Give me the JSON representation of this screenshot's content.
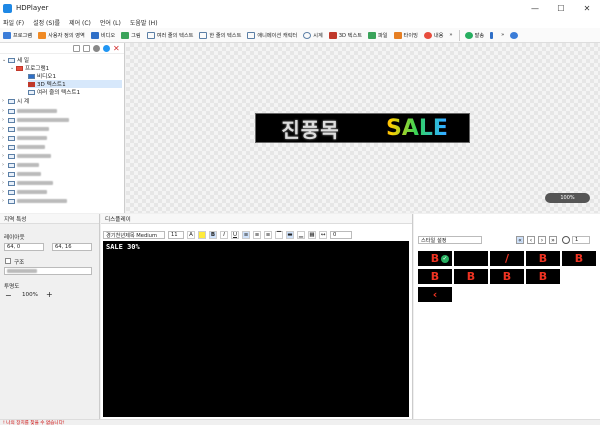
{
  "window": {
    "title": "HDPlayer",
    "min": "—",
    "max": "☐",
    "close": "✕"
  },
  "menu": [
    "파일 (F)",
    "설정 (S)를",
    "제어 (C)",
    "언어 (L)",
    "도움말 (H)"
  ],
  "toolbar": {
    "items": [
      {
        "label": "프로그램",
        "color": "#3b7dd8"
      },
      {
        "label": "사용자 정의 영역",
        "color": "#f08a24"
      },
      {
        "label": "비디오",
        "color": "#2f6fc7"
      },
      {
        "label": "그림",
        "color": "#3aa35a"
      },
      {
        "label": "여러 줄의 텍스트",
        "color": "#5b7fa6"
      },
      {
        "label": "한 줄의 텍스트",
        "color": "#5b7fa6"
      },
      {
        "label": "애니메이션 캐릭터",
        "color": "#5b7fa6"
      },
      {
        "label": "시계",
        "color": "#5b7fa6"
      },
      {
        "label": "3D 텍스트",
        "color": "#c0392b"
      },
      {
        "label": "파일",
        "color": "#3aa35a"
      },
      {
        "label": "타이밍",
        "color": "#e67e22"
      },
      {
        "label": "내용",
        "color": "#e74c3c"
      },
      {
        "label": "발송",
        "color": "#27ae60"
      }
    ],
    "more": "»"
  },
  "tree": {
    "screen_label": "세 일",
    "program_label": "프로그램1",
    "items": [
      "비디오1",
      "3D 텍스트1",
      "여러 줄의 텍스트1"
    ],
    "screen2_label": "시 계"
  },
  "preview": {
    "korean_text": "진풍목",
    "sale_text": "SALE",
    "zoom": "100%"
  },
  "props": {
    "header": "지역 특성",
    "area_label": "레이아웃",
    "pos_x": "64, 0",
    "size": "64, 16",
    "border_label": "구조",
    "transparency_label": "투명도",
    "transparency_value": "100%"
  },
  "display": {
    "header": "디스플레이",
    "font": "경기천년제목 Medium",
    "size": "11",
    "bold": "B",
    "italic": "I",
    "underline": "U",
    "spacing": "0",
    "text": "SALE 30%"
  },
  "effects": {
    "style_select": "스타일 설정",
    "page": "1"
  },
  "status": "! 나의 장치를 찾을 수 없습니다!"
}
